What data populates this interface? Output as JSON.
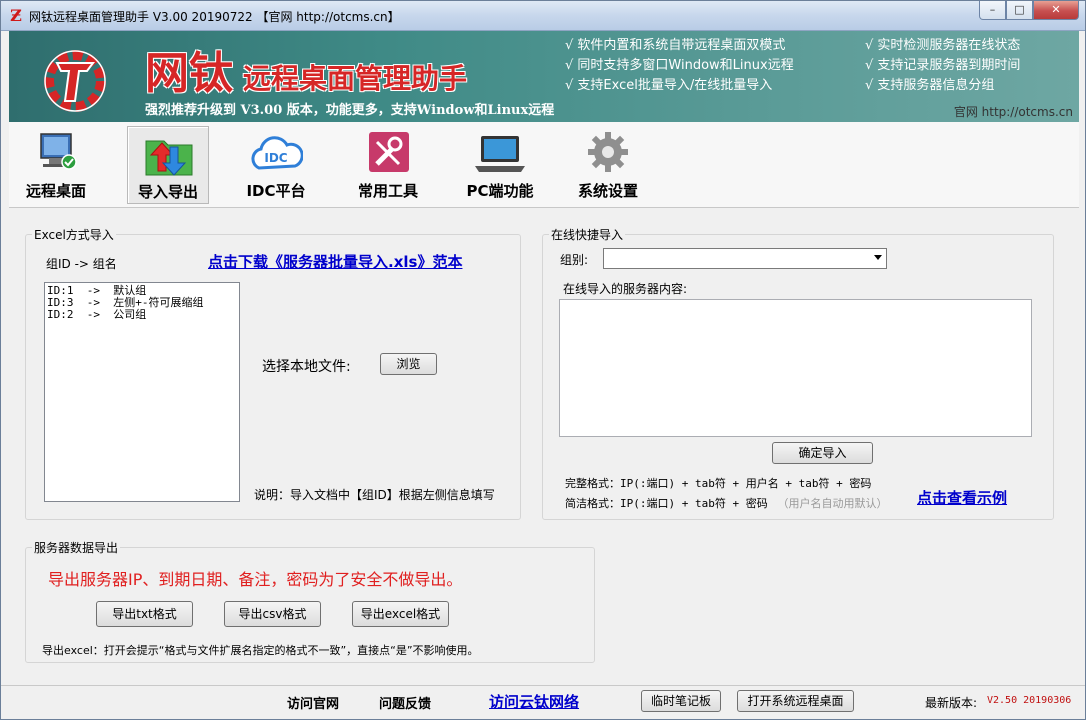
{
  "window": {
    "title": "网钛远程桌面管理助手 V3.00 20190722 【官网 http://otcms.cn】",
    "controls": [
      "minimize",
      "maximize",
      "close"
    ]
  },
  "banner": {
    "title_big": "网钛",
    "title_small": "远程桌面管理助手",
    "subtitle": "强烈推荐升级到 V3.00 版本，功能更多，支持Window和Linux远程",
    "features_left": [
      "√ 软件内置和系统自带远程桌面双模式",
      "√ 同时支持多窗口Window和Linux远程",
      "√ 支持Excel批量导入/在线批量导入"
    ],
    "features_right": [
      "√ 实时检测服务器在线状态",
      "√ 支持记录服务器到期时间",
      "√ 支持服务器信息分组"
    ],
    "site": "官网  http://otcms.cn"
  },
  "toolbar": {
    "items": [
      {
        "label": "远程桌面",
        "icon": "remote-desktop-icon"
      },
      {
        "label": "导入导出",
        "icon": "import-export-icon",
        "active": true
      },
      {
        "label": "IDC平台",
        "icon": "idc-cloud-icon"
      },
      {
        "label": "常用工具",
        "icon": "tools-icon"
      },
      {
        "label": "PC端功能",
        "icon": "laptop-icon"
      },
      {
        "label": "系统设置",
        "icon": "gear-icon"
      }
    ],
    "idc_text": "IDC"
  },
  "excel_import": {
    "title": "Excel方式导入",
    "header": "组ID -> 组名",
    "download_link": "点击下载《服务器批量导入.xls》范本",
    "groups": [
      "ID:1  ->  默认组",
      "ID:3  ->  左侧+-符可展缩组",
      "ID:2  ->  公司组"
    ],
    "choose_file_label": "选择本地文件:",
    "browse_button": "浏览",
    "note": "说明：导入文档中【组ID】根据左侧信息填写"
  },
  "online_import": {
    "title": "在线快捷导入",
    "group_label": "组别:",
    "group_value": "",
    "content_label": "在线导入的服务器内容:",
    "content_value": "",
    "confirm_button": "确定导入",
    "format_full": "完整格式：IP(:端口) + tab符 + 用户名 + tab符 + 密码",
    "format_simple": "简洁格式：IP(:端口) + tab符 + 密码",
    "format_simple_hint": "（用户名自动用默认）",
    "example_link": "点击查看示例"
  },
  "export": {
    "title": "服务器数据导出",
    "headline": "导出服务器IP、到期日期、备注，密码为了安全不做导出。",
    "buttons": [
      "导出txt格式",
      "导出csv格式",
      "导出excel格式"
    ],
    "note": "导出excel：打开会提示“格式与文件扩展名指定的格式不一致”，直接点“是”不影响使用。"
  },
  "statusbar": {
    "visit_site": "访问官网",
    "feedback": "问题反馈",
    "visit_cloud": "访问云钛网络",
    "notepad_button": "临时笔记板",
    "open_rdp_button": "打开系统远程桌面",
    "latest_label": "最新版本:",
    "latest_version": "V2.50 20190306"
  },
  "colors": {
    "banner_bg": "#3f8a86",
    "brand_red": "#d62626",
    "link_blue": "#0000cc",
    "export_red": "#e02020"
  }
}
